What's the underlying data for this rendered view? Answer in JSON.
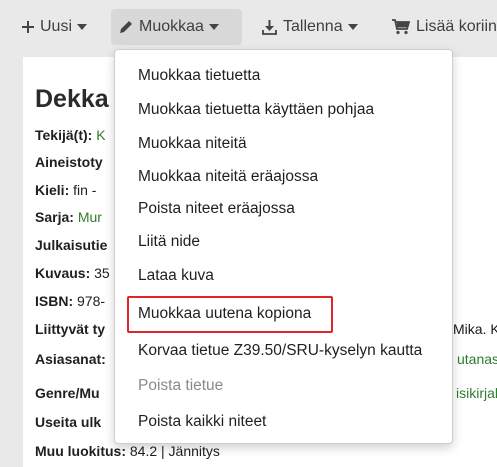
{
  "toolbar": {
    "new_label": "Uusi",
    "edit_label": "Muokkaa",
    "save_label": "Tallenna",
    "cart_label": "Lisää koriin"
  },
  "record": {
    "title": "Dekka",
    "rows": [
      {
        "label": "Tekijä(t):",
        "value": "K"
      },
      {
        "label": "Aineistoty",
        "value": ""
      },
      {
        "label": "Kieli:",
        "value": "fin -"
      },
      {
        "label": "Sarja:",
        "value": "Mur"
      },
      {
        "label": "Julkaisutie",
        "value": ""
      },
      {
        "label": "Kuvaus:",
        "value": "35"
      },
      {
        "label": "ISBN:",
        "value": "978-"
      },
      {
        "label": "Liittyvät ty",
        "value": ""
      },
      {
        "label": "Asiasanat:",
        "value": ""
      },
      {
        "label": "Genre/Mu",
        "value": ""
      },
      {
        "label": "Useita ulk",
        "value": ""
      },
      {
        "label": "Muu luokitus:",
        "value": "84.2 | Jännitys"
      }
    ],
    "right_fragments": {
      "related": "Mika. Kı",
      "subjects": "utanas",
      "genre": "isikirjal"
    }
  },
  "menu": {
    "items": [
      {
        "label": "Muokkaa tietuetta",
        "enabled": true
      },
      {
        "label": "Muokkaa tietuetta käyttäen pohjaa",
        "enabled": true
      },
      {
        "label": "Muokkaa niteitä",
        "enabled": true
      },
      {
        "label": "Muokkaa niteitä eräajossa",
        "enabled": true
      },
      {
        "label": "Poista niteet eräajossa",
        "enabled": true
      },
      {
        "label": "Liitä nide",
        "enabled": true
      },
      {
        "label": "Lataa kuva",
        "enabled": true
      },
      {
        "label": "Muokkaa uutena kopiona",
        "enabled": true,
        "highlighted": true
      },
      {
        "label": "Korvaa tietue Z39.50/SRU-kyselyn kautta",
        "enabled": true
      },
      {
        "label": "Poista tietue",
        "enabled": false
      },
      {
        "label": "Poista kaikki niteet",
        "enabled": true
      }
    ]
  },
  "colors": {
    "highlight_border": "#e0242a",
    "link_green": "#2e7d2e",
    "disabled_text": "#8a8a8a"
  }
}
